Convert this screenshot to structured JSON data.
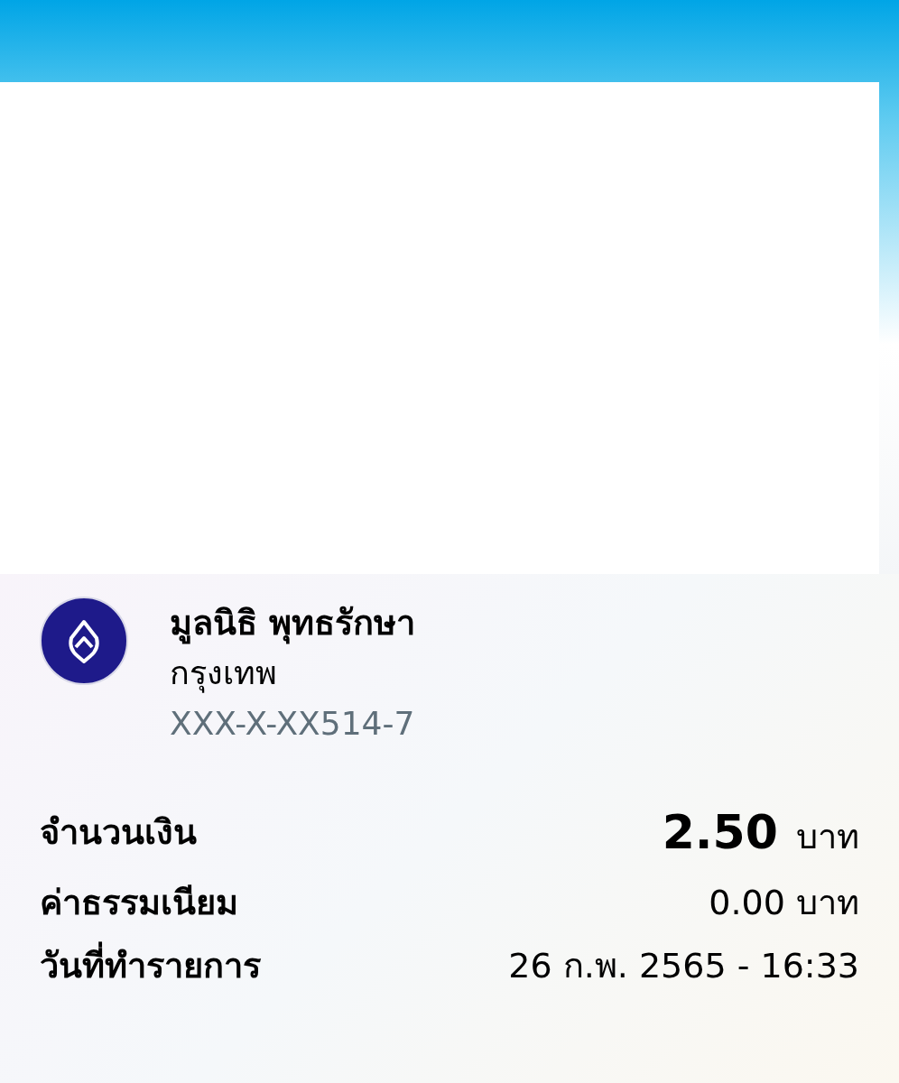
{
  "recipient": {
    "name": "มูลนิธิ พุทธรักษา",
    "bank": "กรุงเทพ",
    "account": "XXX-X-XX514-7"
  },
  "details": [
    {
      "kind": "amount",
      "label": "จำนวนเงิน",
      "value": "2.50",
      "unit": "บาท"
    },
    {
      "kind": "plain",
      "label": "ค่าธรรมเนียม",
      "value": "0.00 บาท"
    },
    {
      "kind": "plain",
      "label": "วันที่ทำรายการ",
      "value": "26 ก.พ. 2565 - 16:33"
    }
  ]
}
